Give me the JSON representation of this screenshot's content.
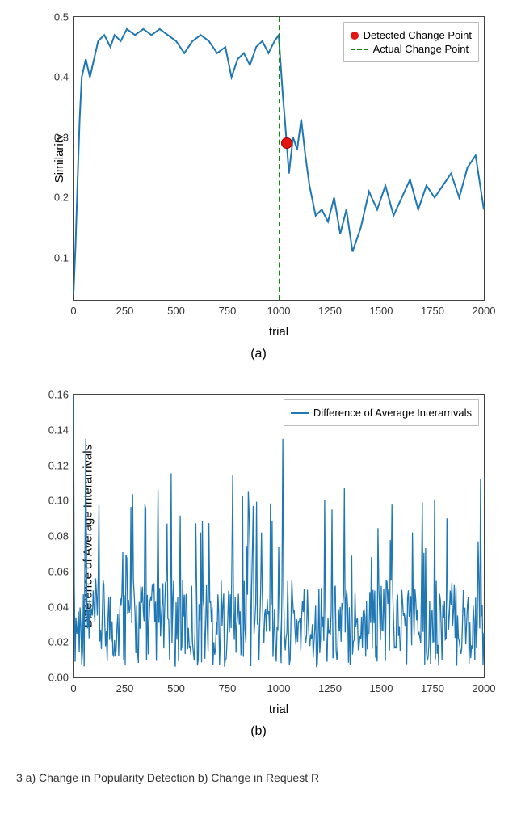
{
  "chart_data": [
    {
      "id": "a",
      "type": "line",
      "title": "",
      "xlabel": "trial",
      "ylabel": "Similarity",
      "xlim": [
        0,
        2000
      ],
      "ylim": [
        0.03,
        0.5
      ],
      "xticks": [
        0,
        250,
        500,
        750,
        1000,
        1250,
        1500,
        1750,
        2000
      ],
      "yticks": [
        0.1,
        0.2,
        0.3,
        0.4,
        0.5
      ],
      "legend": [
        {
          "marker": "dot-red",
          "label": "Detected Change Point"
        },
        {
          "marker": "dash-green",
          "label": "Actual Change Point"
        }
      ],
      "actual_change_x": 1000,
      "detected_change": {
        "x": 1040,
        "y": 0.29
      },
      "series": [
        {
          "name": "Similarity",
          "color": "#1f77b4",
          "x": [
            0,
            10,
            20,
            30,
            40,
            60,
            80,
            100,
            120,
            150,
            180,
            200,
            230,
            260,
            300,
            340,
            380,
            420,
            460,
            500,
            540,
            580,
            620,
            660,
            700,
            740,
            770,
            800,
            830,
            860,
            890,
            920,
            950,
            980,
            1000,
            1010,
            1020,
            1030,
            1050,
            1070,
            1090,
            1110,
            1130,
            1150,
            1180,
            1210,
            1240,
            1270,
            1300,
            1330,
            1360,
            1400,
            1440,
            1480,
            1520,
            1560,
            1600,
            1640,
            1680,
            1720,
            1760,
            1800,
            1840,
            1880,
            1920,
            1960,
            2000
          ],
          "y": [
            0.04,
            0.12,
            0.23,
            0.33,
            0.4,
            0.43,
            0.4,
            0.43,
            0.46,
            0.47,
            0.45,
            0.47,
            0.46,
            0.48,
            0.47,
            0.48,
            0.47,
            0.48,
            0.47,
            0.46,
            0.44,
            0.46,
            0.47,
            0.46,
            0.44,
            0.45,
            0.4,
            0.43,
            0.44,
            0.42,
            0.45,
            0.46,
            0.44,
            0.46,
            0.47,
            0.42,
            0.37,
            0.33,
            0.24,
            0.3,
            0.28,
            0.33,
            0.27,
            0.22,
            0.17,
            0.18,
            0.16,
            0.2,
            0.14,
            0.18,
            0.11,
            0.15,
            0.21,
            0.18,
            0.22,
            0.17,
            0.2,
            0.23,
            0.18,
            0.22,
            0.2,
            0.22,
            0.24,
            0.2,
            0.25,
            0.27,
            0.18
          ]
        }
      ],
      "subfig_label": "(a)"
    },
    {
      "id": "b",
      "type": "line",
      "title": "",
      "xlabel": "trial",
      "ylabel": "Difference of Average Interarrivals",
      "xlim": [
        0,
        2000
      ],
      "ylim": [
        0,
        0.16
      ],
      "xticks": [
        0,
        250,
        500,
        750,
        1000,
        1250,
        1500,
        1750,
        2000
      ],
      "yticks": [
        0.0,
        0.02,
        0.04,
        0.06,
        0.08,
        0.1,
        0.12,
        0.14,
        0.16
      ],
      "legend": [
        {
          "marker": "line-blue",
          "label": "Difference of Average Interarrivals"
        }
      ],
      "series": [
        {
          "name": "Difference of Average Interarrivals",
          "color": "#1f77b4",
          "dense_spikes": true,
          "notable_peaks_x": [
            0,
            60,
            350,
            620,
            1020,
            1260,
            1650,
            1970
          ],
          "notable_peaks_y": [
            0.16,
            0.135,
            0.095,
            0.082,
            0.135,
            0.095,
            0.082,
            0.077
          ],
          "baseline_mean": 0.03,
          "num_points": 2000
        }
      ],
      "subfig_label": "(b)"
    }
  ],
  "caption": "3    a) Change in Popularity Detection b) Change in Request R"
}
